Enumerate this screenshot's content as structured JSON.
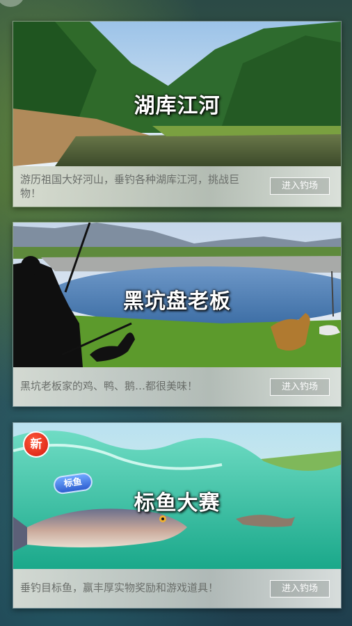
{
  "cards": [
    {
      "title": "湖库江河",
      "description": "游历祖国大好河山，垂钓各种湖库江河，挑战巨物！",
      "button": "进入钓场"
    },
    {
      "title": "黑坑盘老板",
      "description": "黑坑老板家的鸡、鸭、鹅…都很美味！",
      "button": "进入钓场"
    },
    {
      "title": "标鱼大赛",
      "description": "垂钓目标鱼，赢丰厚实物奖励和游戏道具！",
      "button": "进入钓场",
      "badge": "新",
      "tag": "标鱼"
    }
  ],
  "colors": {
    "button_border": "#ffffff",
    "badge": "#e0261a"
  }
}
